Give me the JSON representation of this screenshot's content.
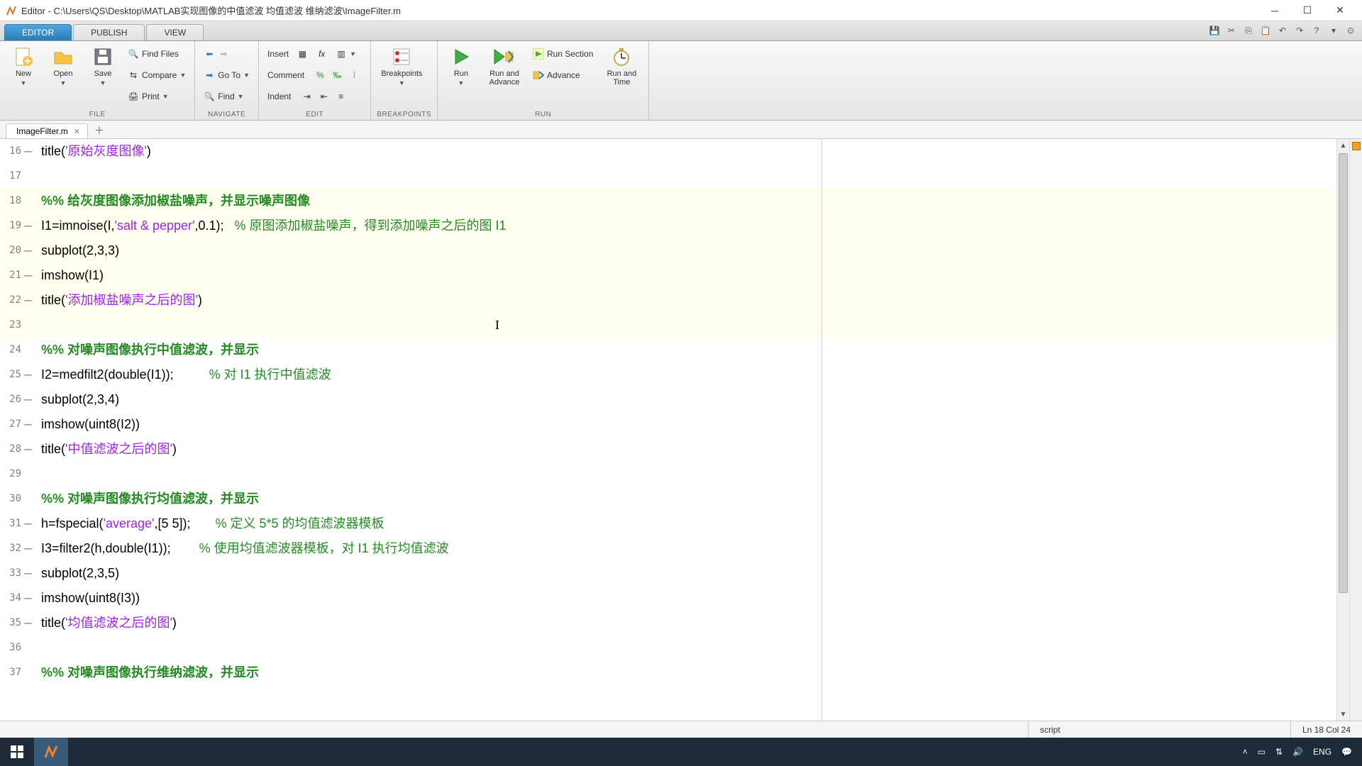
{
  "window": {
    "title": "Editor - C:\\Users\\QS\\Desktop\\MATLAB实现图像的中值滤波 均值滤波 维纳滤波\\ImageFilter.m"
  },
  "tabs": {
    "editor": "EDITOR",
    "publish": "PUBLISH",
    "view": "VIEW"
  },
  "toolstrip": {
    "file": {
      "new": "New",
      "open": "Open",
      "save": "Save",
      "findfiles": "Find Files",
      "compare": "Compare",
      "print": "Print",
      "group": "FILE"
    },
    "navigate": {
      "goto": "Go To",
      "find": "Find",
      "group": "NAVIGATE"
    },
    "edit": {
      "insert": "Insert",
      "comment": "Comment",
      "indent": "Indent",
      "group": "EDIT"
    },
    "breakpoints": {
      "label": "Breakpoints",
      "group": "BREAKPOINTS"
    },
    "run": {
      "run": "Run",
      "runadvance": "Run and\nAdvance",
      "runsection": "Run Section",
      "advance": "Advance",
      "runtime": "Run and\nTime",
      "group": "RUN"
    }
  },
  "filetab": {
    "name": "ImageFilter.m"
  },
  "code": {
    "lines": [
      {
        "n": 16,
        "dash": true,
        "cell": false,
        "seg": [
          {
            "t": "title(",
            "c": ""
          },
          {
            "t": "'原始灰度图像'",
            "c": "s-str"
          },
          {
            "t": ")",
            "c": ""
          }
        ]
      },
      {
        "n": 17,
        "dash": false,
        "cell": false,
        "seg": [
          {
            "t": "",
            "c": ""
          }
        ]
      },
      {
        "n": 18,
        "dash": false,
        "cell": true,
        "seg": [
          {
            "t": "%% 给灰度图像添加椒盐噪声，并显示噪声图像",
            "c": "s-cmt s-bold"
          }
        ]
      },
      {
        "n": 19,
        "dash": true,
        "cell": true,
        "seg": [
          {
            "t": "I1=imnoise(I,",
            "c": ""
          },
          {
            "t": "'salt & pepper'",
            "c": "s-str"
          },
          {
            "t": ",0.1);   ",
            "c": ""
          },
          {
            "t": "% 原图添加椒盐噪声，得到添加噪声之后的图 I1",
            "c": "s-cmt"
          }
        ]
      },
      {
        "n": 20,
        "dash": true,
        "cell": true,
        "seg": [
          {
            "t": "subplot(2,3,3)",
            "c": ""
          }
        ]
      },
      {
        "n": 21,
        "dash": true,
        "cell": true,
        "seg": [
          {
            "t": "imshow(I1)",
            "c": ""
          }
        ]
      },
      {
        "n": 22,
        "dash": true,
        "cell": true,
        "seg": [
          {
            "t": "title(",
            "c": ""
          },
          {
            "t": "'添加椒盐噪声之后的图'",
            "c": "s-str"
          },
          {
            "t": ")",
            "c": ""
          }
        ]
      },
      {
        "n": 23,
        "dash": false,
        "cell": true,
        "seg": [
          {
            "t": "",
            "c": ""
          }
        ]
      },
      {
        "n": 24,
        "dash": false,
        "cell": false,
        "seg": [
          {
            "t": "%% 对噪声图像执行中值滤波，并显示",
            "c": "s-cmt s-bold"
          }
        ]
      },
      {
        "n": 25,
        "dash": true,
        "cell": false,
        "seg": [
          {
            "t": "I2=medfilt2(double(I1));          ",
            "c": ""
          },
          {
            "t": "% 对 I1 执行中值滤波",
            "c": "s-cmt"
          }
        ]
      },
      {
        "n": 26,
        "dash": true,
        "cell": false,
        "seg": [
          {
            "t": "subplot(2,3,4)",
            "c": ""
          }
        ]
      },
      {
        "n": 27,
        "dash": true,
        "cell": false,
        "seg": [
          {
            "t": "imshow(uint8(I2))",
            "c": ""
          }
        ]
      },
      {
        "n": 28,
        "dash": true,
        "cell": false,
        "seg": [
          {
            "t": "title(",
            "c": ""
          },
          {
            "t": "'中值滤波之后的图'",
            "c": "s-str"
          },
          {
            "t": ")",
            "c": ""
          }
        ]
      },
      {
        "n": 29,
        "dash": false,
        "cell": false,
        "seg": [
          {
            "t": "",
            "c": ""
          }
        ]
      },
      {
        "n": 30,
        "dash": false,
        "cell": false,
        "seg": [
          {
            "t": "%% 对噪声图像执行均值滤波，并显示",
            "c": "s-cmt s-bold"
          }
        ]
      },
      {
        "n": 31,
        "dash": true,
        "cell": false,
        "seg": [
          {
            "t": "h=fspecial(",
            "c": ""
          },
          {
            "t": "'average'",
            "c": "s-str"
          },
          {
            "t": ",[5 5]);       ",
            "c": ""
          },
          {
            "t": "% 定义 5*5 的均值滤波器模板",
            "c": "s-cmt"
          }
        ]
      },
      {
        "n": 32,
        "dash": true,
        "cell": false,
        "seg": [
          {
            "t": "I3=filter2(h,double(I1));        ",
            "c": ""
          },
          {
            "t": "% 使用均值滤波器模板，对 I1 执行均值滤波",
            "c": "s-cmt"
          }
        ]
      },
      {
        "n": 33,
        "dash": true,
        "cell": false,
        "seg": [
          {
            "t": "subplot(2,3,5)",
            "c": ""
          }
        ]
      },
      {
        "n": 34,
        "dash": true,
        "cell": false,
        "seg": [
          {
            "t": "imshow(uint8(I3))",
            "c": ""
          }
        ]
      },
      {
        "n": 35,
        "dash": true,
        "cell": false,
        "seg": [
          {
            "t": "title(",
            "c": ""
          },
          {
            "t": "'均值滤波之后的图'",
            "c": "s-str"
          },
          {
            "t": ")",
            "c": ""
          }
        ]
      },
      {
        "n": 36,
        "dash": false,
        "cell": false,
        "seg": [
          {
            "t": "",
            "c": ""
          }
        ]
      },
      {
        "n": 37,
        "dash": false,
        "cell": false,
        "seg": [
          {
            "t": "%% 对噪声图像执行维纳滤波，并显示",
            "c": "s-cmt s-bold"
          }
        ]
      }
    ]
  },
  "status": {
    "type": "script",
    "pos": "Ln  18   Col  24"
  },
  "tray": {
    "lang": "ENG"
  }
}
